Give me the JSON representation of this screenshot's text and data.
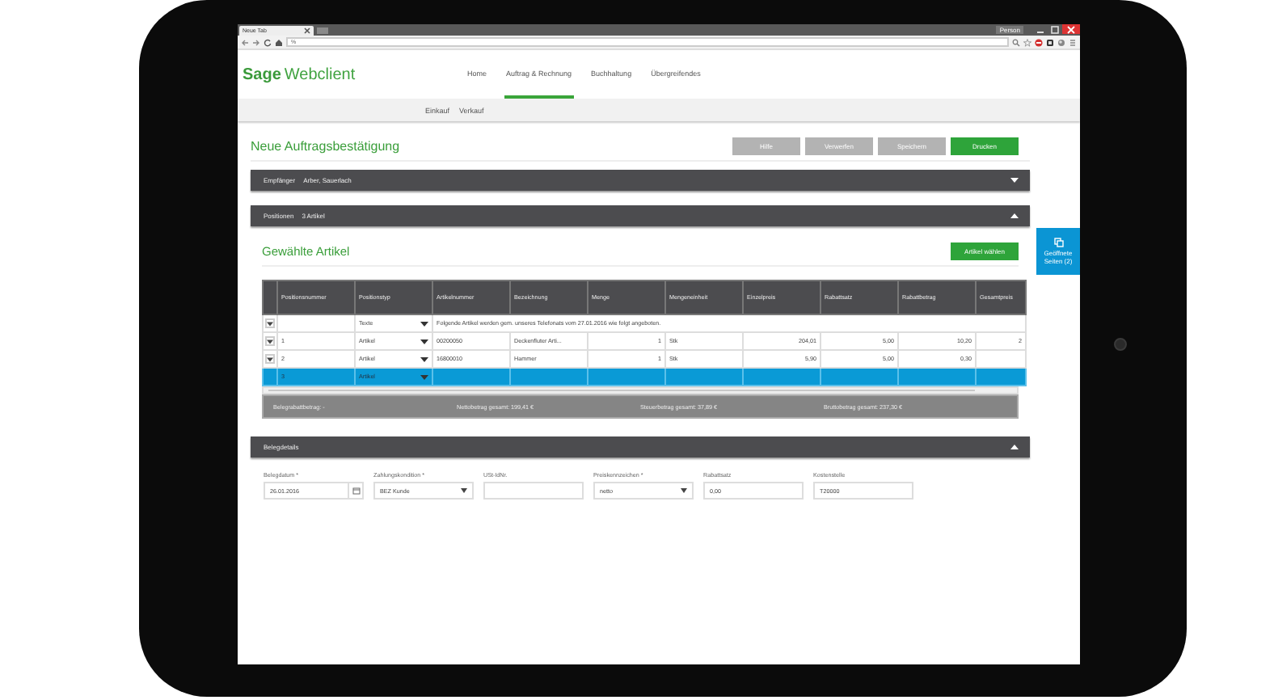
{
  "browser": {
    "tab": "Neue Tab",
    "profile": "Person",
    "address": "%"
  },
  "app": {
    "brand": "Sage",
    "product": "Webclient"
  },
  "nav": [
    {
      "label": "Home",
      "selected": false
    },
    {
      "label": "Auftrag & Rechnung",
      "selected": true
    },
    {
      "label": "Buchhaltung",
      "selected": false
    },
    {
      "label": "Übergreifendes",
      "selected": false
    }
  ],
  "subnav": [
    {
      "label": "Einkauf"
    },
    {
      "label": "Verkauf"
    }
  ],
  "page": {
    "title": "Neue Auftragsbestätigung",
    "actions": [
      {
        "label": "Hilfe",
        "primary": false
      },
      {
        "label": "Verwerfen",
        "primary": false
      },
      {
        "label": "Speichern",
        "primary": false
      },
      {
        "label": "Drucken",
        "primary": true
      }
    ]
  },
  "recipient_bar": {
    "label": "Empfänger",
    "value": "Arber, Sauerlach",
    "expanded": false
  },
  "positions_bar": {
    "label": "Positionen",
    "value": "3 Artikel",
    "expanded": true
  },
  "articles": {
    "title": "Gewählte Artikel",
    "button": "Artikel wählen",
    "columns": [
      "Positionsnummer",
      "Positionstyp",
      "Artikelnummer",
      "Bezeichnung",
      "Menge",
      "Mengeneinheit",
      "Einzelpreis",
      "Rabattsatz",
      "Rabattbetrag",
      "Gesamtpreis"
    ],
    "rows": [
      {
        "kind": "text",
        "selected": false,
        "type": "Texte",
        "text": "Folgende Artikel werden gem. unseres Telefonats vom 27.01.2016 wie folgt angeboten."
      },
      {
        "kind": "item",
        "selected": false,
        "cells": [
          "1",
          "Artikel",
          "00200050",
          "Deckenfluter Arti...",
          "1",
          "Stk",
          "204,01",
          "5,00",
          "10,20",
          "2"
        ]
      },
      {
        "kind": "item",
        "selected": false,
        "cells": [
          "2",
          "Artikel",
          "16800010",
          "Hammer",
          "1",
          "Stk",
          "5,90",
          "5,00",
          "0,30",
          ""
        ]
      },
      {
        "kind": "new",
        "selected": true,
        "cells": [
          "3",
          "Artikel"
        ]
      }
    ],
    "summary": [
      "Belegrabattbetrag: -",
      "Nettobetrag gesamt: 199,41 €",
      "Steuerbetrag gesamt: 37,89 €",
      "Bruttobetrag gesamt: 237,30 €"
    ]
  },
  "details_bar": {
    "label": "Belegdetails",
    "expanded": true
  },
  "details_fields": [
    {
      "kind": "date",
      "label": "Belegdatum *",
      "value": "26.01.2016"
    },
    {
      "kind": "select",
      "label": "Zahlungskondition *",
      "value": "BEZ Kunde"
    },
    {
      "kind": "text",
      "label": "USt-IdNr."
    },
    {
      "kind": "select",
      "label": "Preiskennzeichen *",
      "value": "netto"
    },
    {
      "kind": "text",
      "label": "Rabattsatz",
      "value": "0,00"
    },
    {
      "kind": "text",
      "label": "Kostenstelle",
      "value": "T20000"
    }
  ],
  "side_tab": {
    "label": "Geöffnete Seiten (2)"
  }
}
